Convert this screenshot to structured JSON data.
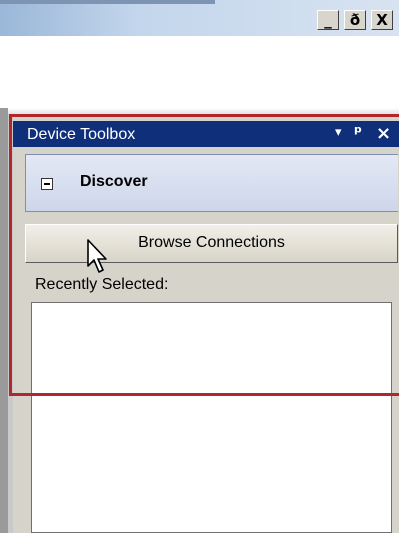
{
  "window": {
    "controls": [
      "_",
      "ð",
      "X"
    ]
  },
  "panel": {
    "title": "Device Toolbox",
    "header_icons": {
      "dropdown": "▾",
      "pin": "ᵖ",
      "close": "×"
    },
    "section": {
      "label": "Discover",
      "state": "expanded"
    },
    "browse_button": "Browse Connections",
    "recent_label": "Recently Selected:",
    "recent_items": []
  },
  "colors": {
    "header_bg": "#0f2f7a",
    "highlight_border": "#b2272e",
    "panel_bg": "#d6d3ca"
  }
}
